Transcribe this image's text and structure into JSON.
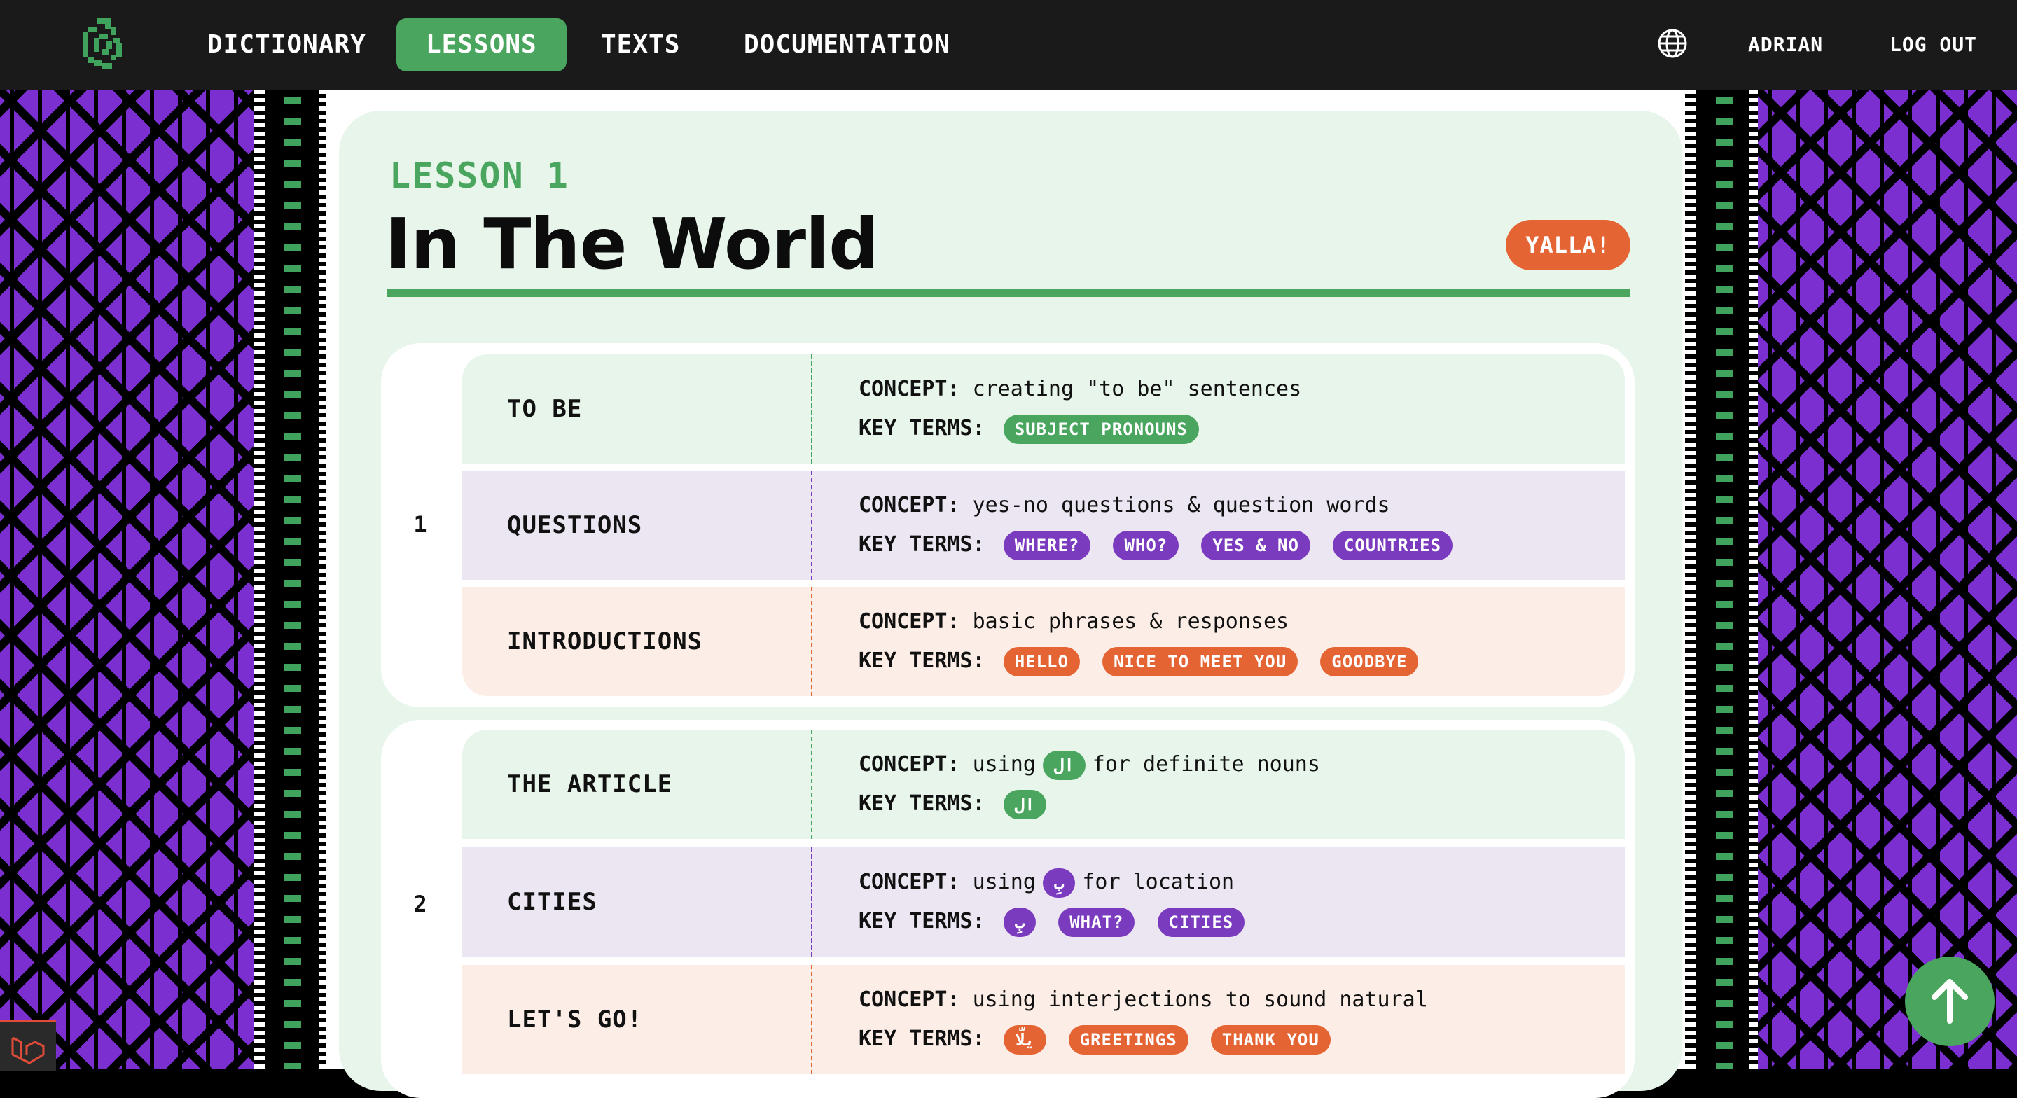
{
  "nav": {
    "links": [
      "DICTIONARY",
      "LESSONS",
      "TEXTS",
      "DOCUMENTATION"
    ],
    "active": "LESSONS",
    "user": "ADRIAN",
    "logout": "LOG OUT",
    "icons": {
      "logo": "spiral-logo",
      "language": "globe-icon"
    }
  },
  "lesson": {
    "label": "LESSON 1",
    "title": "In The World",
    "action": "YALLA!"
  },
  "labels": {
    "concept": "CONCEPT:",
    "key_terms": "KEY TERMS:"
  },
  "units": [
    {
      "number": "1",
      "rows": [
        {
          "title": "TO BE",
          "color": "green",
          "concept": "creating \"to be\" sentences",
          "terms": [
            "SUBJECT PRONOUNS"
          ]
        },
        {
          "title": "QUESTIONS",
          "color": "purple",
          "concept": "yes-no questions & question words",
          "terms": [
            "WHERE?",
            "WHO?",
            "YES & NO",
            "COUNTRIES"
          ]
        },
        {
          "title": "INTRODUCTIONS",
          "color": "orange",
          "concept": "basic phrases & responses",
          "terms": [
            "HELLO",
            "NICE TO MEET YOU",
            "GOODBYE"
          ]
        }
      ]
    },
    {
      "number": "2",
      "rows": [
        {
          "title": "THE ARTICLE",
          "color": "green",
          "concept_pre": "using",
          "concept_pill": "ال",
          "concept_post": "for definite nouns",
          "terms": [
            "ال"
          ]
        },
        {
          "title": "CITIES",
          "color": "purple",
          "concept_pre": "using",
          "concept_pill": "بِ",
          "concept_post": "for location",
          "terms": [
            "بِ",
            "WHAT?",
            "CITIES"
          ]
        },
        {
          "title": "LET'S GO!",
          "color": "orange",
          "concept": "using interjections to sound natural",
          "terms": [
            "يلّا",
            "GREETINGS",
            "THANK YOU"
          ]
        }
      ]
    }
  ],
  "colors": {
    "green": "#4aa65f",
    "purple": "#7a3bbf",
    "orange": "#e56434",
    "pattern": "#7b2fd0"
  },
  "fab_icon": "arrow-up-icon"
}
